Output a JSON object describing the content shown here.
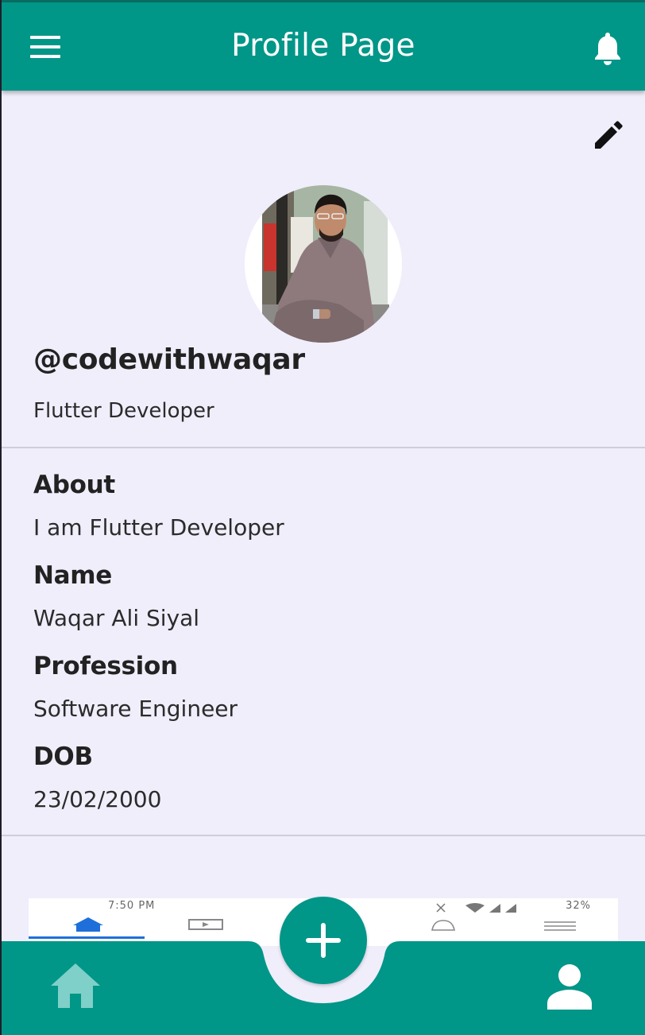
{
  "app_bar": {
    "title": "Profile Page",
    "menu_icon": "hamburger-menu-icon",
    "notification_icon": "bell-icon"
  },
  "profile": {
    "edit_icon": "pencil-edit-icon",
    "avatar": "profile-photo",
    "username": "@codewithwaqar",
    "role": "Flutter Developer"
  },
  "details": [
    {
      "label": "About",
      "value": "I am Flutter Developer"
    },
    {
      "label": "Name",
      "value": "Waqar Ali Siyal"
    },
    {
      "label": "Profession",
      "value": "Software Engineer"
    },
    {
      "label": "DOB",
      "value": "23/02/2000"
    }
  ],
  "screenshot_strip": {
    "time": "7:50 PM",
    "battery": "32%"
  },
  "bottom_nav": {
    "home_icon": "home-icon",
    "add_icon": "plus-icon",
    "profile_icon": "person-icon"
  },
  "colors": {
    "primary": "#009688",
    "background": "#f0eefb",
    "home_icon_faded": "#7fd0c8",
    "text_dark": "#222222"
  }
}
